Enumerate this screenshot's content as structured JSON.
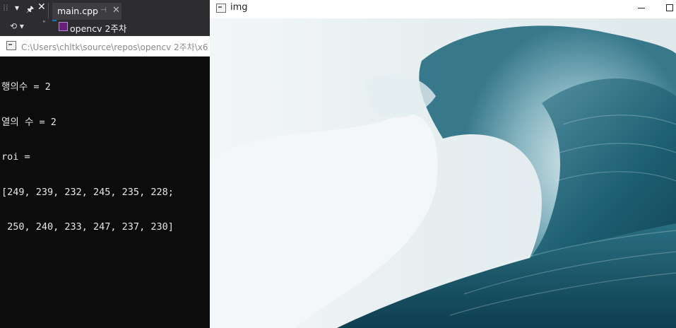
{
  "ide": {
    "tab_label": "main.cpp",
    "tab_pin_icon": "pin-icon",
    "tab_close_icon": "close-icon",
    "project_combo_label": "opencv 2주차"
  },
  "console": {
    "title_path": "C:\\Users\\chltk\\source\\repos\\opencv 2주차\\x6",
    "lines": [
      "행의수 = 2",
      "열의 수 = 2",
      "roi =",
      "[249, 239, 232, 245, 235, 228;",
      " 250, 240, 233, 247, 237, 230]"
    ],
    "background": "#0c0c0c",
    "text_color": "#e6e6e6"
  },
  "img_window": {
    "title": "img",
    "minimize_icon": "minimize-icon",
    "maximize_icon": "maximize-icon"
  },
  "colors": {
    "ide_bg": "#2d2d30",
    "accent": "#007acc",
    "wave_dark": "#0f4a5c",
    "wave_light": "#eef3f4"
  }
}
